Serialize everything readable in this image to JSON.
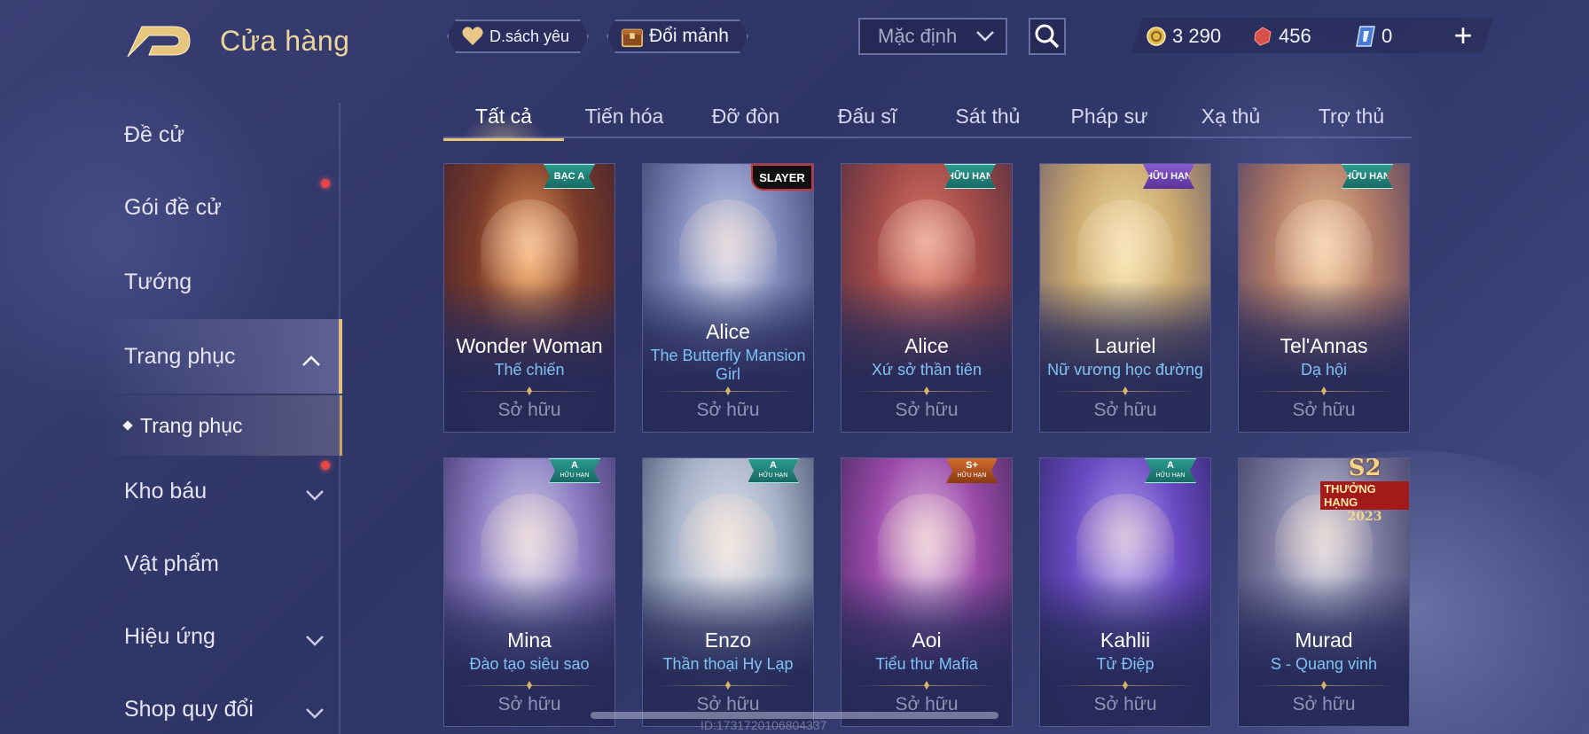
{
  "header": {
    "title": "Cửa hàng",
    "wishlist_label": "D.sách yêu",
    "fragments_label": "Đổi mảnh",
    "sort_value": "Mặc định"
  },
  "currency": {
    "gold": "3 290",
    "gems": "456",
    "vouchers": "0"
  },
  "sidebar": {
    "items": [
      {
        "label": "Đề cử"
      },
      {
        "label": "Gói đề cử"
      },
      {
        "label": "Tướng"
      },
      {
        "label": "Trang phục"
      },
      {
        "label": "Kho báu"
      },
      {
        "label": "Vật phẩm"
      },
      {
        "label": "Hiệu ứng"
      },
      {
        "label": "Shop quy đổi"
      }
    ],
    "sub_item": "Trang phục"
  },
  "tabs": [
    "Tất cả",
    "Tiến hóa",
    "Đỡ đòn",
    "Đấu sĩ",
    "Sát thủ",
    "Pháp sư",
    "Xạ thủ",
    "Trợ thủ"
  ],
  "cards": [
    {
      "hero": "Wonder Woman",
      "skin": "Thế chiến",
      "status": "Sở hữu",
      "badge": "BẠC A",
      "colors": [
        "#f2a25a",
        "#7a3a2a",
        "#3b2030"
      ]
    },
    {
      "hero": "Alice",
      "skin": "The Butterfly Mansion Girl",
      "status": "Sở hữu",
      "badge": "SLAYER",
      "colors": [
        "#cfd6ef",
        "#7c86b8",
        "#303660"
      ]
    },
    {
      "hero": "Alice",
      "skin": "Xứ sở thần tiên",
      "status": "Sở hữu",
      "badge": "HỮU HẠN",
      "colors": [
        "#e07a6a",
        "#a04a48",
        "#4a2c40"
      ]
    },
    {
      "hero": "Lauriel",
      "skin": "Nữ vương học đường",
      "status": "Sở hữu",
      "badge": "HỮU HẠN",
      "colors": [
        "#f4e2a6",
        "#caa86e",
        "#6a5a70"
      ]
    },
    {
      "hero": "Tel'Annas",
      "skin": "Dạ hội",
      "status": "Sở hữu",
      "badge": "HỮU HẠN",
      "colors": [
        "#f0c89a",
        "#b07a66",
        "#4a3a62"
      ]
    },
    {
      "hero": "Mina",
      "skin": "Đào tạo siêu sao",
      "status": "Sở hữu",
      "badge": "A",
      "badge_sub": "HỮU HẠN",
      "colors": [
        "#d8d6ee",
        "#8a7cc0",
        "#3a2e66"
      ]
    },
    {
      "hero": "Enzo",
      "skin": "Thần thoại Hy Lạp",
      "status": "Sở hữu",
      "badge": "A",
      "badge_sub": "HỮU HẠN",
      "colors": [
        "#e6e8f0",
        "#a8b2c8",
        "#3e4666"
      ]
    },
    {
      "hero": "Aoi",
      "skin": "Tiểu thư Mafia",
      "status": "Sở hữu",
      "badge": "S+",
      "badge_sub": "HỮU HẠN",
      "colors": [
        "#e2c2e6",
        "#9a4aa8",
        "#3e2658"
      ]
    },
    {
      "hero": "Kahlii",
      "skin": "Tử Điệp",
      "status": "Sở hữu",
      "badge": "A",
      "badge_sub": "HỮU HẠN",
      "colors": [
        "#b6a6f2",
        "#6a4ac2",
        "#2c2466"
      ]
    },
    {
      "hero": "Murad",
      "skin": "S - Quang vinh",
      "status": "Sở hữu",
      "badge": "S2",
      "badge_sub": "THƯỞNG HẠNG",
      "badge_year": "2023",
      "colors": [
        "#d0d4e4",
        "#7c7aa0",
        "#3a3660"
      ]
    }
  ],
  "watermark": "ID:1731720106804337",
  "accent": "#e8c77a"
}
